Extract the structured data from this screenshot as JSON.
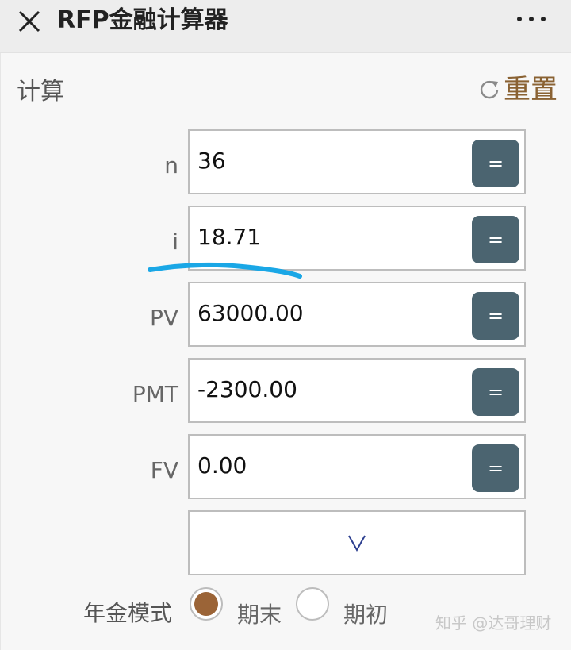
{
  "header": {
    "title": "RFP金融计算器",
    "close_icon": "close-icon",
    "more_icon": "more-icon"
  },
  "toolbar": {
    "section_label": "计算",
    "reset_label": "重置",
    "reset_icon": "refresh-icon"
  },
  "fields": [
    {
      "label": "n",
      "value": "36",
      "button_label": "="
    },
    {
      "label": "i",
      "value": "18.71",
      "button_label": "="
    },
    {
      "label": "PV",
      "value": "63000.00",
      "button_label": "="
    },
    {
      "label": "PMT",
      "value": "-2300.00",
      "button_label": "="
    },
    {
      "label": "FV",
      "value": "0.00",
      "button_label": "="
    }
  ],
  "dropdown": {
    "icon": "chevron-down-icon"
  },
  "annuity": {
    "label": "年金模式",
    "options": [
      {
        "label": "期末",
        "selected": true
      },
      {
        "label": "期初",
        "selected": false
      }
    ]
  },
  "watermark": "知乎 @达哥理财",
  "colors": {
    "accent": "#8a6233",
    "equals_button": "#4b6470",
    "radio_selected": "#9b6437",
    "highlight_annotation": "#1aa7e6"
  }
}
